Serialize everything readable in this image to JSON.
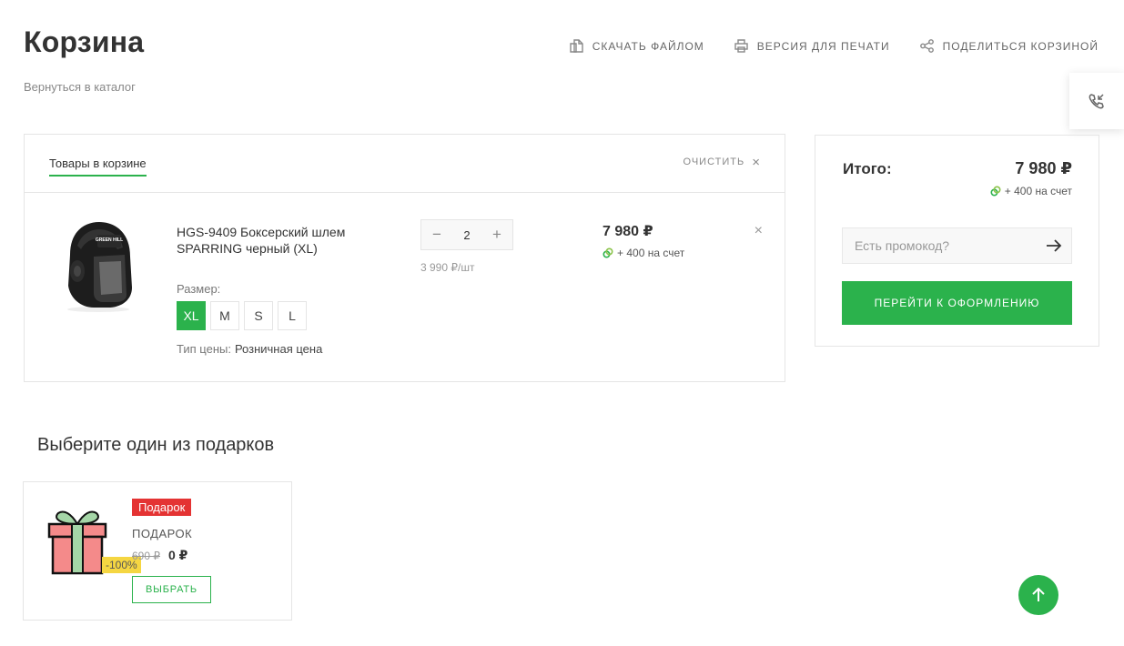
{
  "page": {
    "title": "Корзина",
    "back_link": "Вернуться в каталог"
  },
  "top_actions": {
    "download": "СКАЧАТЬ ФАЙЛОМ",
    "print": "ВЕРСИЯ ДЛЯ ПЕЧАТИ",
    "share": "ПОДЕЛИТЬСЯ КОРЗИНОЙ"
  },
  "cart": {
    "tab_label": "Товары в корзине",
    "clear_label": "ОЧИСТИТЬ",
    "item": {
      "image_label": "GREEN HILL",
      "name": "HGS-9409 Боксерский шлем SPARRING черный (XL)",
      "size_label": "Размер:",
      "sizes": [
        "XL",
        "M",
        "S",
        "L"
      ],
      "selected_size": "XL",
      "price_type_label": "Тип цены:",
      "price_type_value": "Розничная цена",
      "quantity": "2",
      "unit_price": "3 990 ₽/шт",
      "total": "7 980 ₽",
      "bonus": "+ 400 на счет"
    }
  },
  "summary": {
    "total_label": "Итого:",
    "total_value": "7 980 ₽",
    "bonus": "+ 400 на счет",
    "promo_placeholder": "Есть промокод?",
    "checkout_label": "ПЕРЕЙТИ К ОФОРМЛЕНИЮ"
  },
  "gifts": {
    "title": "Выберите один из подарков",
    "items": [
      {
        "badge": "Подарок",
        "discount": "-100%",
        "name": "ПОДАРОК",
        "old_price": "690 ₽",
        "new_price": "0 ₽",
        "button": "ВЫБРАТЬ"
      }
    ]
  },
  "colors": {
    "accent_green": "#2bb24c",
    "badge_red": "#e43333",
    "discount_yellow": "#f5d642"
  },
  "icons": {
    "download": "file-download-icon",
    "print": "printer-icon",
    "share": "share-icon",
    "callback": "phone-callback-icon",
    "scroll_top": "arrow-up-icon"
  }
}
